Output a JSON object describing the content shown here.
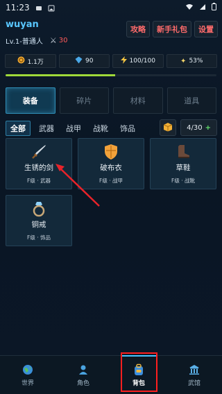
{
  "status_bar": {
    "time": "11:23"
  },
  "header": {
    "username": "wuyan",
    "level": "Lv.1-普通人",
    "power": "30",
    "buttons": [
      "攻略",
      "新手礼包",
      "设置"
    ]
  },
  "stats": [
    {
      "icon": "coin-icon",
      "value": "1.1万"
    },
    {
      "icon": "gem-icon",
      "value": "90"
    },
    {
      "icon": "energy-icon",
      "value": "100/100"
    },
    {
      "icon": "sparkle-icon",
      "value": "53%"
    }
  ],
  "exp_progress": 0.52,
  "tabs": [
    "装备",
    "碎片",
    "材料",
    "道具"
  ],
  "active_tab": "装备",
  "filters": [
    "全部",
    "武器",
    "战甲",
    "战靴",
    "饰品"
  ],
  "active_filter": "全部",
  "capacity": {
    "value": "4/30",
    "plus": "+"
  },
  "items": [
    {
      "name": "生锈的剑",
      "meta": "F级 · 武器",
      "icon": "sword-icon"
    },
    {
      "name": "破布衣",
      "meta": "F级 · 战甲",
      "icon": "shield-icon"
    },
    {
      "name": "草鞋",
      "meta": "F级 · 战靴",
      "icon": "boot-icon"
    },
    {
      "name": "铜戒",
      "meta": "F级 · 饰品",
      "icon": "ring-icon"
    }
  ],
  "bottom_nav": [
    {
      "label": "世界",
      "icon": "globe-icon"
    },
    {
      "label": "角色",
      "icon": "person-icon"
    },
    {
      "label": "背包",
      "icon": "backpack-icon",
      "active": true
    },
    {
      "label": "武馆",
      "icon": "temple-icon"
    }
  ],
  "colors": {
    "accent": "#47c4ff",
    "alert": "#ff1f1f",
    "good": "#62e06b"
  }
}
